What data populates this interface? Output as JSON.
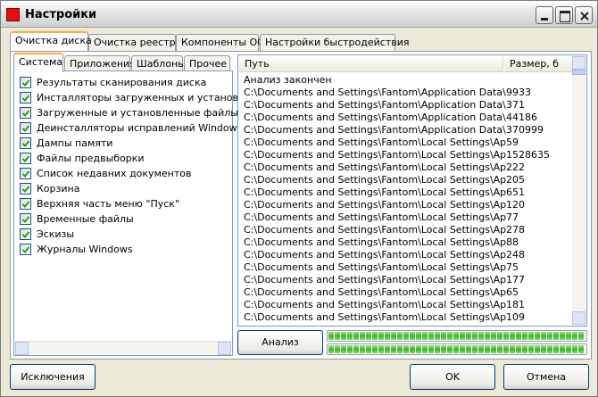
{
  "window": {
    "title": "Настройки"
  },
  "tabs": [
    "Очистка диска",
    "Очистка реестра",
    "Компоненты ОС",
    "Настройки быстродействия"
  ],
  "subtabs": [
    "Система",
    "Приложения",
    "Шаблоны",
    "Прочее"
  ],
  "checklist": [
    "Результаты сканирования диска",
    "Инсталляторы загруженных и установленн",
    "Загруженные и установленные файлы прог",
    "Деинсталляторы исправлений Windows",
    "Дампы памяти",
    "Файлы предвыборки",
    "Список недавних документов",
    "Корзина",
    "Верхняя часть меню \"Пуск\"",
    "Временные файлы",
    "Эскизы",
    "Журналы Windows"
  ],
  "results": {
    "columns": {
      "path": "Путь",
      "size": "Размер, б"
    },
    "status": "Анализ закончен",
    "rows": [
      {
        "path": "C:\\Documents and Settings\\Fantom\\Application Data\\Ope...",
        "size": "9933"
      },
      {
        "path": "C:\\Documents and Settings\\Fantom\\Application Data\\Ope...",
        "size": "371"
      },
      {
        "path": "C:\\Documents and Settings\\Fantom\\Application Data\\Ope...",
        "size": "44186"
      },
      {
        "path": "C:\\Documents and Settings\\Fantom\\Application Data\\Ope...",
        "size": "370999"
      },
      {
        "path": "C:\\Documents and Settings\\Fantom\\Local Settings\\Applic...",
        "size": "59"
      },
      {
        "path": "C:\\Documents and Settings\\Fantom\\Local Settings\\Applic...",
        "size": "1528635"
      },
      {
        "path": "C:\\Documents and Settings\\Fantom\\Local Settings\\Applic...",
        "size": "222"
      },
      {
        "path": "C:\\Documents and Settings\\Fantom\\Local Settings\\Applic...",
        "size": "205"
      },
      {
        "path": "C:\\Documents and Settings\\Fantom\\Local Settings\\Applic...",
        "size": "651"
      },
      {
        "path": "C:\\Documents and Settings\\Fantom\\Local Settings\\Applic...",
        "size": "120"
      },
      {
        "path": "C:\\Documents and Settings\\Fantom\\Local Settings\\Applic...",
        "size": "77"
      },
      {
        "path": "C:\\Documents and Settings\\Fantom\\Local Settings\\Applic...",
        "size": "278"
      },
      {
        "path": "C:\\Documents and Settings\\Fantom\\Local Settings\\Applic...",
        "size": "88"
      },
      {
        "path": "C:\\Documents and Settings\\Fantom\\Local Settings\\Applic...",
        "size": "248"
      },
      {
        "path": "C:\\Documents and Settings\\Fantom\\Local Settings\\Applic...",
        "size": "75"
      },
      {
        "path": "C:\\Documents and Settings\\Fantom\\Local Settings\\Applic...",
        "size": "177"
      },
      {
        "path": "C:\\Documents and Settings\\Fantom\\Local Settings\\Applic...",
        "size": "65"
      },
      {
        "path": "C:\\Documents and Settings\\Fantom\\Local Settings\\Applic...",
        "size": "181"
      },
      {
        "path": "C:\\Documents and Settings\\Fantom\\Local Settings\\Applic...",
        "size": "109"
      }
    ]
  },
  "buttons": {
    "analyze": "Анализ",
    "exclusions": "Исключения",
    "ok": "OK",
    "cancel": "Отмена"
  },
  "progress": {
    "bar1_fraction": 1.0,
    "bar2_fraction": 1.0
  },
  "colors": {
    "accent_tab": "#f7b13b",
    "progress_green": "#40b42a",
    "checkbox_green": "#21a121"
  }
}
